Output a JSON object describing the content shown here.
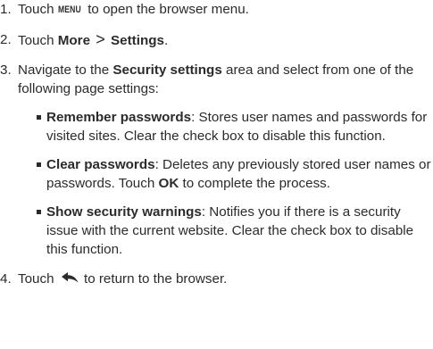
{
  "steps": {
    "s1": {
      "num": "1.",
      "pre": "Touch",
      "key": "MENU",
      "post": " to open the browser menu."
    },
    "s2": {
      "num": "2.",
      "pre": "Touch ",
      "more": "More",
      "gt": ">",
      "settings": "Settings",
      "post": "."
    },
    "s3": {
      "num": "3.",
      "pre": "Navigate to the ",
      "area": "Security settings",
      "post": " area and select from one of the following page settings:",
      "items": [
        {
          "title": "Remember passwords",
          "text": ": Stores user names and passwords for visited sites. Clear the check box to disable this function."
        },
        {
          "title": "Clear passwords",
          "text": ": Deletes any previously stored user names or passwords. Touch ",
          "ok": "OK",
          "text2": " to complete the process."
        },
        {
          "title": "Show security warnings",
          "text": ": Notifies you if there is a security issue with the current website. Clear the check box to disable this function."
        }
      ]
    },
    "s4": {
      "num": "4.",
      "pre": "Touch",
      "icon": "back-arrow-icon",
      "post": " to return to the browser."
    }
  }
}
